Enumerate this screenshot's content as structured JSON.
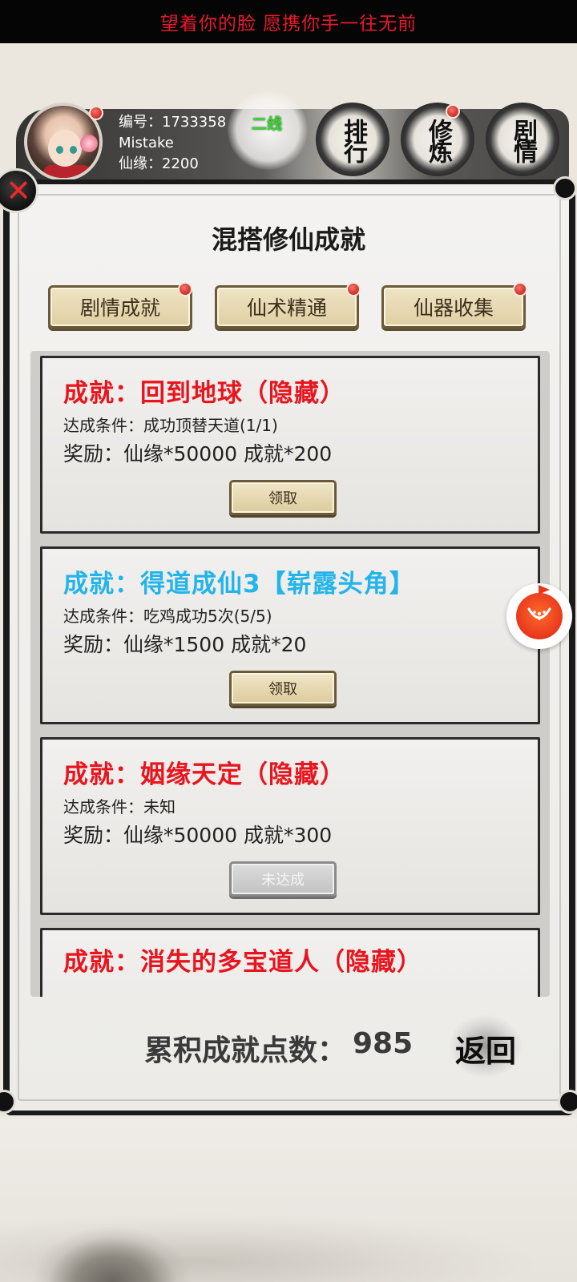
{
  "banner": {
    "text": "望着你的脸 愿携你手一往无前"
  },
  "player": {
    "id_label": "编号：1733358",
    "name": "Mistake",
    "xianyuan_label": "仙缘：2200",
    "line": "二线"
  },
  "nav": {
    "rank": "排行",
    "cultivate": "修炼",
    "story": "剧情"
  },
  "panel": {
    "title": "混搭修仙成就",
    "tabs": [
      "剧情成就",
      "仙术精通",
      "仙器收集"
    ]
  },
  "achievements": [
    {
      "title": "成就：回到地球（隐藏）",
      "title_color": "#e8141e",
      "condition": "达成条件：成功顶替天道(1/1)",
      "reward": "奖励：仙缘*50000 成就*200",
      "button": "领取",
      "button_state": "claimable"
    },
    {
      "title": "成就：得道成仙3【崭露头角】",
      "title_color": "#22b4ea",
      "condition": "达成条件：吃鸡成功5次(5/5)",
      "reward": "奖励：仙缘*1500 成就*20",
      "button": "领取",
      "button_state": "claimable"
    },
    {
      "title": "成就：姻缘天定（隐藏）",
      "title_color": "#e8141e",
      "condition": "达成条件：未知",
      "reward": "奖励：仙缘*50000 成就*300",
      "button": "未达成",
      "button_state": "disabled"
    },
    {
      "title": "成就：消失的多宝道人（隐藏）",
      "title_color": "#e8141e",
      "condition": "",
      "reward": "",
      "button": "",
      "button_state": "hidden"
    }
  ],
  "footer": {
    "total_label": "累积成就点数：",
    "total_value": "985",
    "back": "返回"
  },
  "colors": {
    "red_title": "#e8141e",
    "blue_title": "#22b4ea",
    "line_green": "#34d82c",
    "notify_red": "#d8352c"
  }
}
